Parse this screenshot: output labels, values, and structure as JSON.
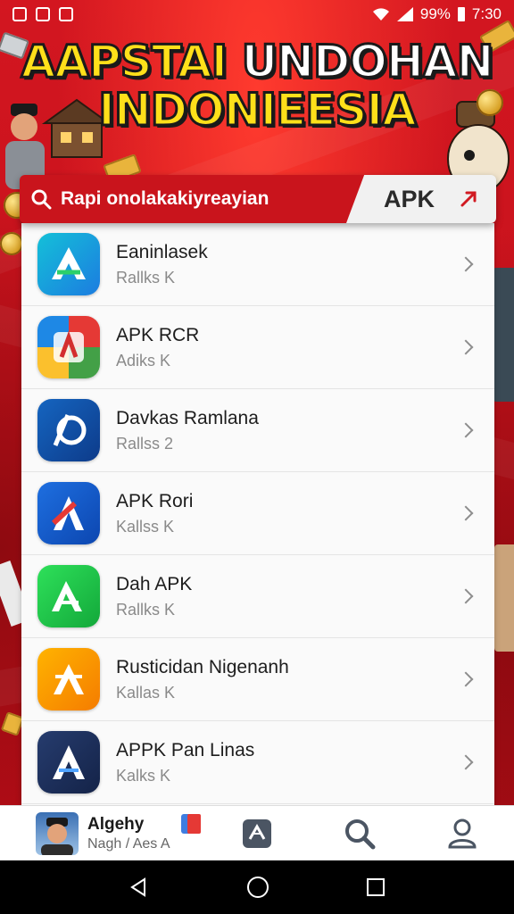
{
  "status_bar": {
    "battery": "99%",
    "time": "7:30"
  },
  "hero": {
    "line1_yellow": "AAPSTAI",
    "line1_white": "UNDOHAN",
    "line2": "INDONIEESIA"
  },
  "search": {
    "query": "Rapi onolakakiyreayian",
    "tag": "APK"
  },
  "apps": [
    {
      "name": "Eaninlasek",
      "sub": "Rallks K",
      "icon": "app-icon-green-a"
    },
    {
      "name": "APK RCR",
      "sub": "Adiks K",
      "icon": "app-icon-multicolor"
    },
    {
      "name": "Davkas Ramlana",
      "sub": "Rallss 2",
      "icon": "app-icon-blue-ab"
    },
    {
      "name": "APK Rori",
      "sub": "Kallss K",
      "icon": "app-icon-blue-red-a"
    },
    {
      "name": "Dah APK",
      "sub": "Rallks K",
      "icon": "app-icon-green-a"
    },
    {
      "name": "Rusticidan Nigenanh",
      "sub": "Kallas K",
      "icon": "app-icon-orange-a"
    },
    {
      "name": "APPK Pan Linas",
      "sub": "Kalks K",
      "icon": "app-icon-navy-a"
    }
  ],
  "bottom_nav": {
    "profile_name": "Algehy",
    "profile_sub": "Nagh / Aes A",
    "items": [
      "apps-icon",
      "search-icon",
      "profile-icon"
    ]
  },
  "colors": {
    "brand_red": "#c9141c",
    "title_yellow": "#ffe01a"
  }
}
